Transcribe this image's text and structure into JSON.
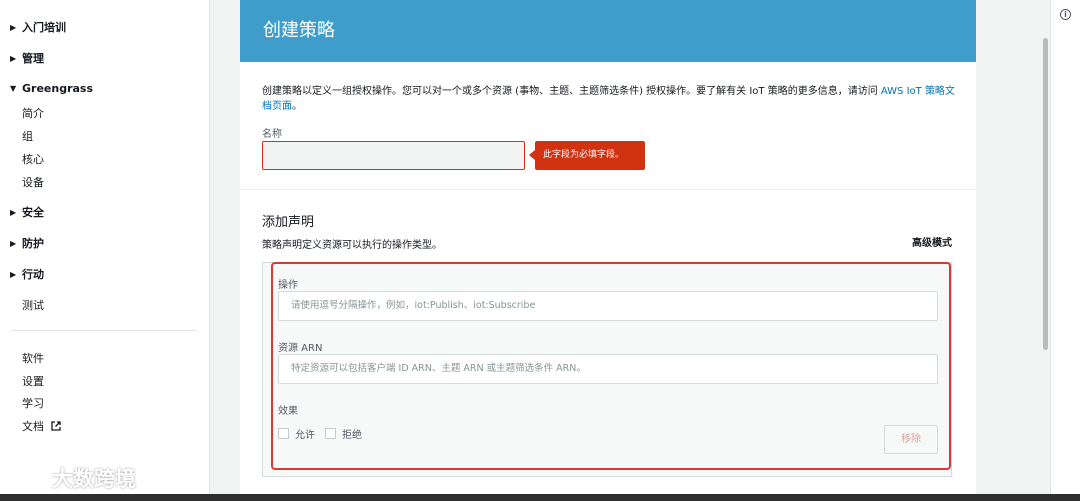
{
  "sidebar": {
    "groups": [
      {
        "label": "入门培训",
        "caret": "▶"
      },
      {
        "label": "管理",
        "caret": "▶"
      },
      {
        "label": "Greengrass",
        "caret": "▼"
      },
      {
        "label": "安全",
        "caret": "▶"
      },
      {
        "label": "防护",
        "caret": "▶"
      },
      {
        "label": "行动",
        "caret": "▶"
      }
    ],
    "greengrass_items": [
      "简介",
      "组",
      "核心",
      "设备"
    ],
    "test_label": "测试",
    "bottom_items": [
      "软件",
      "设置",
      "学习",
      "文档"
    ]
  },
  "panel": {
    "title": "创建策略",
    "description": "创建策略以定义一组授权操作。您可以对一个或多个资源 (事物、主题、主题筛选条件) 授权操作。要了解有关 IoT 策略的更多信息，请访问 ",
    "description_link": "AWS IoT 策略文档页面",
    "description_end": "。",
    "name_label": "名称",
    "name_value": "",
    "error_message": "此字段为必填字段。"
  },
  "statement": {
    "title": "添加声明",
    "subtitle": "策略声明定义资源可以执行的操作类型。",
    "advanced_mode": "高级模式",
    "action_label": "操作",
    "action_placeholder": "请使用逗号分隔操作，例如，iot:Publish、iot:Subscribe",
    "resource_label": "资源 ARN",
    "resource_placeholder": "特定资源可以包括客户端 ID ARN、主题 ARN 或主题筛选条件 ARN。",
    "effect_label": "效果",
    "allow_label": "允许",
    "deny_label": "拒绝",
    "remove_label": "移除"
  },
  "watermark": {
    "text": "大数跨境"
  },
  "colors": {
    "header": "#3f9dcc",
    "error": "#d13212",
    "link": "#0073bb",
    "highlight": "#d63a36"
  }
}
